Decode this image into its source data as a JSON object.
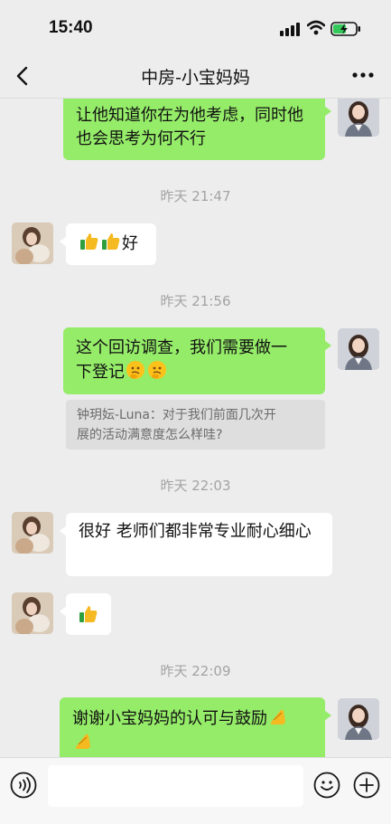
{
  "status": {
    "time": "15:40"
  },
  "nav": {
    "title": "中房-小宝妈妈"
  },
  "messages": [
    {
      "text": "让他知道你在为他考虑，同时他也会思考为何不行"
    },
    {
      "timestamp": "昨天 21:47"
    },
    {
      "text": "好"
    },
    {
      "timestamp": "昨天 21:56"
    },
    {
      "text_line1": "这个回访调查，我们需要做一",
      "text_line2": "下登记"
    },
    {
      "quote_line1": "钟玥妘-Luna：对于我们前面几次开",
      "quote_line2": "展的活动满意度怎么样哇?"
    },
    {
      "timestamp": "昨天 22:03"
    },
    {
      "text": "很好 老师们都非常专业耐心细心"
    },
    {
      "timestamp": "昨天 22:09"
    },
    {
      "text": "谢谢小宝妈妈的认可与鼓励"
    }
  ],
  "icons": {
    "thumbs": "thumbs-up-icon",
    "thinking": "thinking-face-icon",
    "clap": "clapping-hands-icon"
  },
  "colors": {
    "my_bubble": "#95ec69",
    "their_bubble": "#ffffff",
    "background": "#ededed"
  }
}
